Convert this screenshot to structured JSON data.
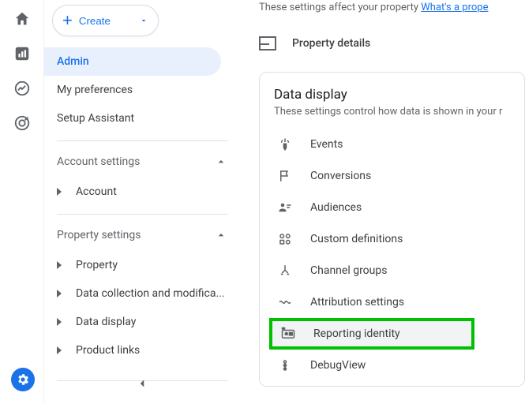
{
  "rail": {
    "icons": [
      "home-icon",
      "bar-chart-icon",
      "explore-icon",
      "target-icon"
    ],
    "gear": "admin-gear-icon"
  },
  "sidebar": {
    "create_label": "Create",
    "nav": {
      "admin": "Admin",
      "prefs": "My preferences",
      "setup": "Setup Assistant"
    },
    "account_settings": {
      "header": "Account settings",
      "items": [
        "Account"
      ]
    },
    "property_settings": {
      "header": "Property settings",
      "items": [
        "Property",
        "Data collection and modifica...",
        "Data display",
        "Product links"
      ]
    }
  },
  "main": {
    "top_hint_prefix": "These settings affect your property ",
    "top_hint_link": "What's a prope",
    "property_details": "Property details",
    "data_display": {
      "title": "Data display",
      "subtitle": "These settings control how data is shown in your r",
      "rows": [
        {
          "icon": "touch-icon",
          "label": "Events"
        },
        {
          "icon": "flag-icon",
          "label": "Conversions"
        },
        {
          "icon": "people-icon",
          "label": "Audiences"
        },
        {
          "icon": "custom-def-icon",
          "label": "Custom definitions"
        },
        {
          "icon": "channel-icon",
          "label": "Channel groups"
        },
        {
          "icon": "attribution-icon",
          "label": "Attribution settings"
        },
        {
          "icon": "identity-icon",
          "label": "Reporting identity"
        },
        {
          "icon": "debug-icon",
          "label": "DebugView"
        }
      ]
    }
  }
}
